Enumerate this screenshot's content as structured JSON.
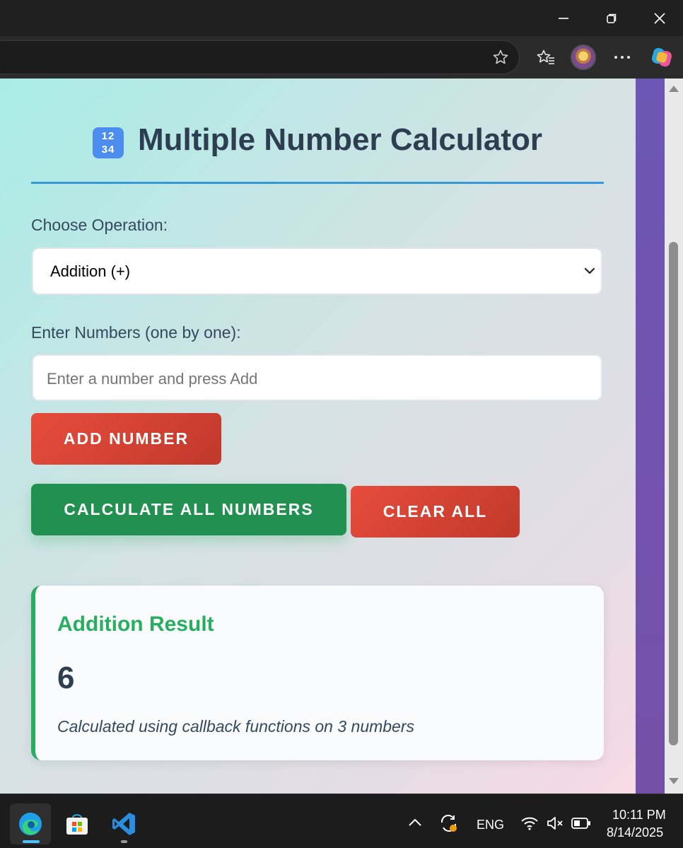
{
  "app": {
    "title": "Multiple Number Calculator",
    "title_emoji": "1234"
  },
  "form": {
    "operation_label": "Choose Operation:",
    "operation_selected": "Addition (+)",
    "numbers_label": "Enter Numbers (one by one):",
    "number_placeholder": "Enter a number and press Add",
    "add_button": "ADD NUMBER",
    "calculate_button": "CALCULATE ALL NUMBERS",
    "clear_button": "CLEAR ALL"
  },
  "result": {
    "title": "Addition Result",
    "value": "6",
    "note": "Calculated using callback functions on 3 numbers"
  },
  "taskbar": {
    "language": "ENG",
    "time": "10:11 PM",
    "date": "8/14/2025"
  },
  "colors": {
    "accent_blue": "#3498db",
    "add_red": "#e74c3c",
    "calc_green": "#229050",
    "result_green": "#27ae60"
  }
}
